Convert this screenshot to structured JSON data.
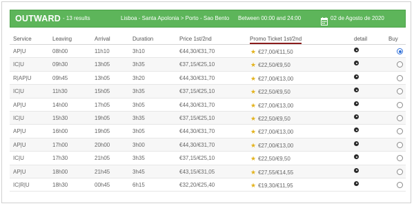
{
  "banner": {
    "title": "OUTWARD",
    "count": "- 13 results",
    "route": "Lisboa - Santa Apolonia > Porto - Sao Bento",
    "time_window": "Between 00:00 and 24:00",
    "date": "02 de Agosto de 2020",
    "color": "#5db55a"
  },
  "columns": {
    "service": "Service",
    "leaving": "Leaving",
    "arrival": "Arrival",
    "duration": "Duration",
    "price": "Price 1st/2nd",
    "promo": "Promo Ticket 1st/2nd",
    "detail": "detail",
    "buy": "Buy"
  },
  "rows": [
    {
      "service": "AP|U",
      "leaving": "08h00",
      "arrival": "11h10",
      "duration": "3h10",
      "price": "€44,30/€31,70",
      "promo": "€27,00/€11,50",
      "selected": true
    },
    {
      "service": "IC|U",
      "leaving": "09h30",
      "arrival": "13h05",
      "duration": "3h35",
      "price": "€37,15/€25,10",
      "promo": "€22,50/€9,50",
      "selected": false
    },
    {
      "service": "R|AP|U",
      "leaving": "09h45",
      "arrival": "13h05",
      "duration": "3h20",
      "price": "€44,30/€31,70",
      "promo": "€27,00/€13,00",
      "selected": false
    },
    {
      "service": "IC|U",
      "leaving": "11h30",
      "arrival": "15h05",
      "duration": "3h35",
      "price": "€37,15/€25,10",
      "promo": "€22,50/€9,50",
      "selected": false
    },
    {
      "service": "AP|U",
      "leaving": "14h00",
      "arrival": "17h05",
      "duration": "3h05",
      "price": "€44,30/€31,70",
      "promo": "€27,00/€13,00",
      "selected": false
    },
    {
      "service": "IC|U",
      "leaving": "15h30",
      "arrival": "19h05",
      "duration": "3h35",
      "price": "€37,15/€25,10",
      "promo": "€22,50/€9,50",
      "selected": false
    },
    {
      "service": "AP|U",
      "leaving": "16h00",
      "arrival": "19h05",
      "duration": "3h05",
      "price": "€44,30/€31,70",
      "promo": "€27,00/€13,00",
      "selected": false
    },
    {
      "service": "AP|U",
      "leaving": "17h00",
      "arrival": "20h00",
      "duration": "3h00",
      "price": "€44,30/€31,70",
      "promo": "€27,00/€13,00",
      "selected": false
    },
    {
      "service": "IC|U",
      "leaving": "17h30",
      "arrival": "21h05",
      "duration": "3h35",
      "price": "€37,15/€25,10",
      "promo": "€22,50/€9,50",
      "selected": false
    },
    {
      "service": "AP|U",
      "leaving": "18h00",
      "arrival": "21h45",
      "duration": "3h45",
      "price": "€43,15/€31,05",
      "promo": "€27,55/€14,55",
      "selected": false
    },
    {
      "service": "IC|R|U",
      "leaving": "18h30",
      "arrival": "00h45",
      "duration": "6h15",
      "price": "€32,20/€25,40",
      "promo": "€19,30/€11,95",
      "selected": false
    }
  ],
  "icons": {
    "calendar": "calendar-icon",
    "promo_star": "star-icon",
    "detail": "info-icon"
  },
  "accent_colors": {
    "promo_underline": "#8b1c1c",
    "star": "#e3b21b",
    "radio_selected": "#2f6fd8"
  }
}
